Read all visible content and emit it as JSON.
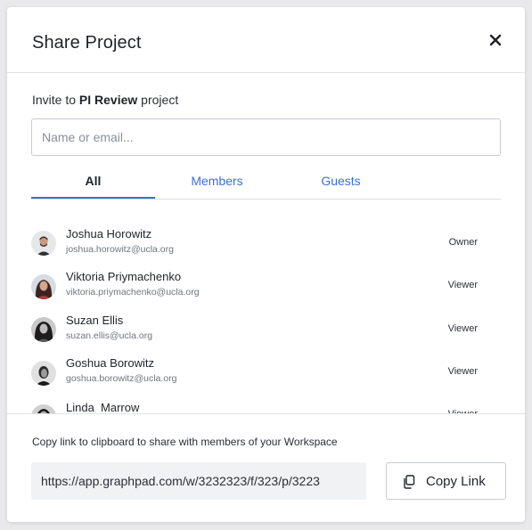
{
  "dialog": {
    "title": "Share Project",
    "close_icon": "close-icon"
  },
  "invite": {
    "prefix": "Invite to ",
    "project": "PI Review",
    "suffix": " project"
  },
  "search": {
    "placeholder": "Name or email...",
    "value": ""
  },
  "tabs": [
    {
      "label": "All",
      "active": true
    },
    {
      "label": "Members",
      "active": false
    },
    {
      "label": "Guests",
      "active": false
    }
  ],
  "members": [
    {
      "name": "Joshua Horowitz",
      "email": "joshua.horowitz@ucla.org",
      "role": "Owner",
      "avatar": "avatar-icon"
    },
    {
      "name": "Viktoria Priymachenko",
      "email": "viktoria.priymachenko@ucla.org",
      "role": "Viewer",
      "avatar": "avatar-icon"
    },
    {
      "name": "Suzan Ellis",
      "email": "suzan.ellis@ucla.org",
      "role": "Viewer",
      "avatar": "avatar-icon"
    },
    {
      "name": "Goshua Borowitz",
      "email": "goshua.borowitz@ucla.org",
      "role": "Viewer",
      "avatar": "avatar-icon"
    },
    {
      "name": "Linda  Marrow",
      "email": "",
      "role": "Viewer",
      "avatar": "avatar-icon"
    }
  ],
  "footer": {
    "copy_text": "Copy link to clipboard to share with members of your Workspace",
    "link": "https://app.graphpad.com/w/3232323/f/323/p/3223",
    "copy_button": "Copy Link",
    "copy_icon": "copy-icon"
  },
  "colors": {
    "accent": "#3b6fd8",
    "border": "#c9ccd2",
    "link_bg": "#f1f2f4"
  }
}
